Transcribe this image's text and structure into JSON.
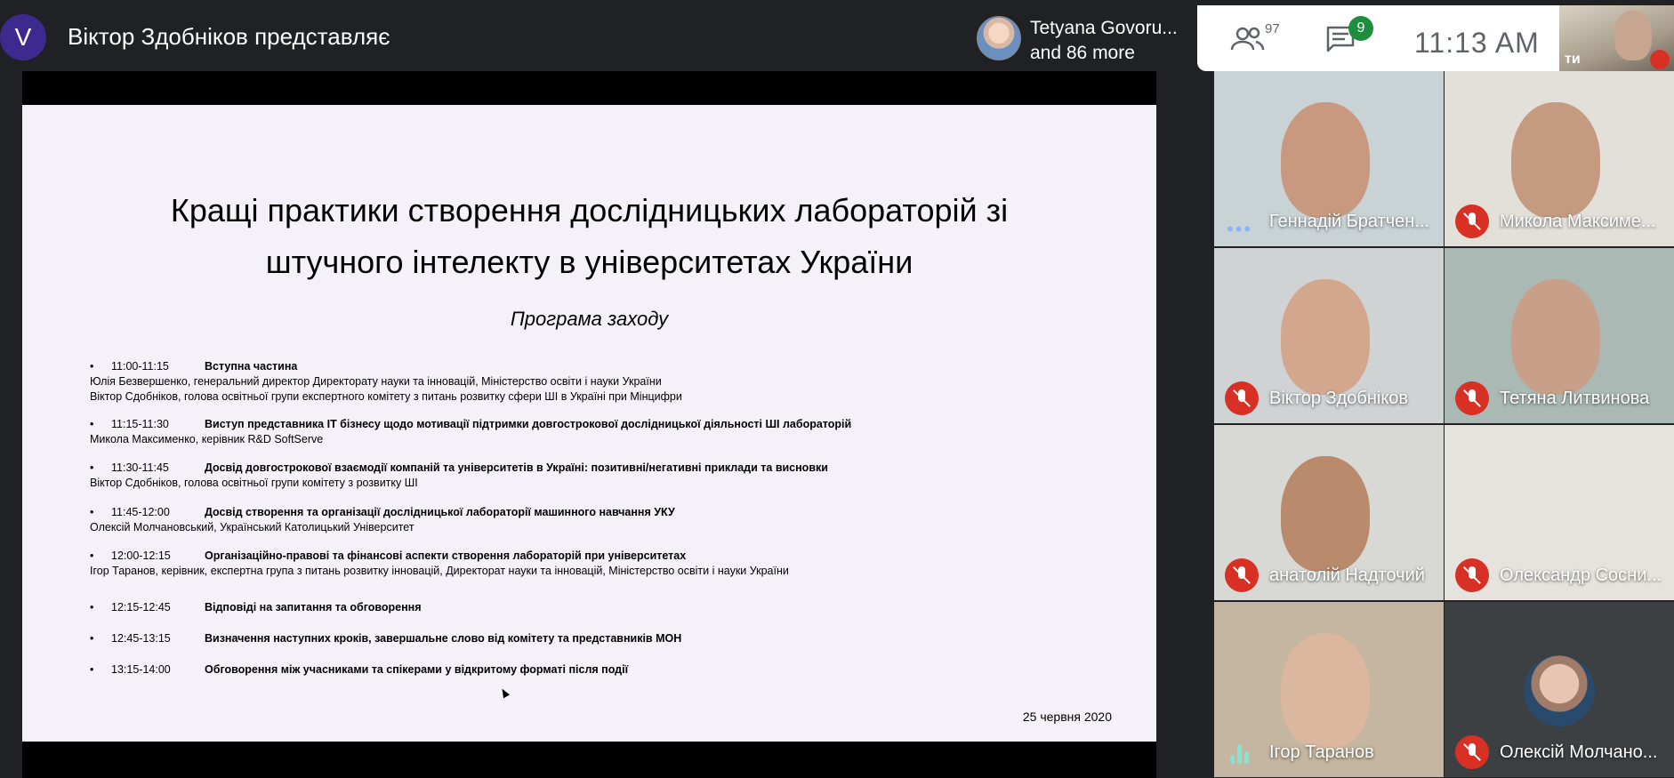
{
  "header": {
    "presenter_initial": "V",
    "presenting_text": "Віктор Здобніков представляє",
    "participants_preview": {
      "name": "Tetyana Govoru...",
      "more": "and 86 more"
    },
    "people_count": "97",
    "chat_badge": "9",
    "clock": "11:13  AM",
    "self_label": "ти"
  },
  "slide": {
    "title_line1": "Кращі практики створення дослідницьких лабораторій зі",
    "title_line2": "штучного інтелекту в університетах України",
    "subtitle": "Програма заходу",
    "bullet": "•",
    "agenda": [
      {
        "time": "11:00-11:15",
        "title": "Вступна частина",
        "speakers": [
          "Юлія Безвершенко, генеральний директор Директорату науки та інновацій, Міністерство освіти і науки України",
          "Віктор Сдобніков, голова освітньої групи експертного комітету з питань розвитку сфери ШІ в Україні при Мінцифри"
        ]
      },
      {
        "time": "11:15-11:30",
        "title": "Виступ представника IT бізнесу щодо мотивації підтримки довгострокової дослідницької діяльності ШІ лабораторій",
        "speakers": [
          "Микола Максименко, керівник R&D SoftServe"
        ]
      },
      {
        "time": "11:30-11:45",
        "title": "Досвід довгострокової взаємодії компаній та університетів в Україні: позитивні/негативні приклади та висновки",
        "speakers": [
          "Віктор Сдобніков, голова освітньої групи комітету з розвитку ШІ"
        ]
      },
      {
        "time": "11:45-12:00",
        "title": "Досвід створення та організації дослідницької лабораторії машинного навчання УКУ",
        "speakers": [
          "Олексій Молчановський, Український Католицький Університет"
        ]
      },
      {
        "time": "12:00-12:15",
        "title": "Організаційно-правові та фінансові аспекти створення лабораторій при університетах",
        "speakers": [
          "Ігор Таранов, керівник, експертна група з питань розвитку інновацій, Директорат науки та інновацій, Міністерство освіти і науки України"
        ]
      },
      {
        "time": "12:15-12:45",
        "title": "Відповіді на запитання та обговорення",
        "speakers": []
      },
      {
        "time": "12:45-13:15",
        "title": "Визначення наступних кроків, завершальне слово від комітету та представників МОН",
        "speakers": []
      },
      {
        "time": "13:15-14:00",
        "title": "Обговорення між учасниками та спікерами у відкритому форматі після події",
        "speakers": []
      }
    ],
    "date": "25 червня 2020"
  },
  "participants": [
    {
      "name": "Геннадій Братчен...",
      "status": "speaking-dots",
      "bg": "#c9d3d6",
      "face": "#c9997f"
    },
    {
      "name": "Микола Максиме...",
      "status": "muted",
      "bg": "#e3e0da",
      "face": "#c49a80"
    },
    {
      "name": "Віктор Здобніков",
      "status": "muted",
      "bg": "#cfd3d4",
      "face": "#d2a78e"
    },
    {
      "name": "Тетяна Литвинова",
      "status": "muted",
      "bg": "#aab9b4",
      "face": "#c8a08a"
    },
    {
      "name": "анатолій Надточий",
      "status": "muted",
      "bg": "#d8d8d4",
      "face": "#b98a6c"
    },
    {
      "name": "Олександр Сосни...",
      "status": "muted",
      "bg": "#e6e3dc",
      "face": ""
    },
    {
      "name": "Ігор Таранов",
      "status": "speaking-wave",
      "bg": "#c4b6a0",
      "face": "#dcb79f"
    },
    {
      "name": "Олексій Молчано...",
      "status": "muted",
      "bg": "#3c4043",
      "face": "avatar"
    }
  ]
}
